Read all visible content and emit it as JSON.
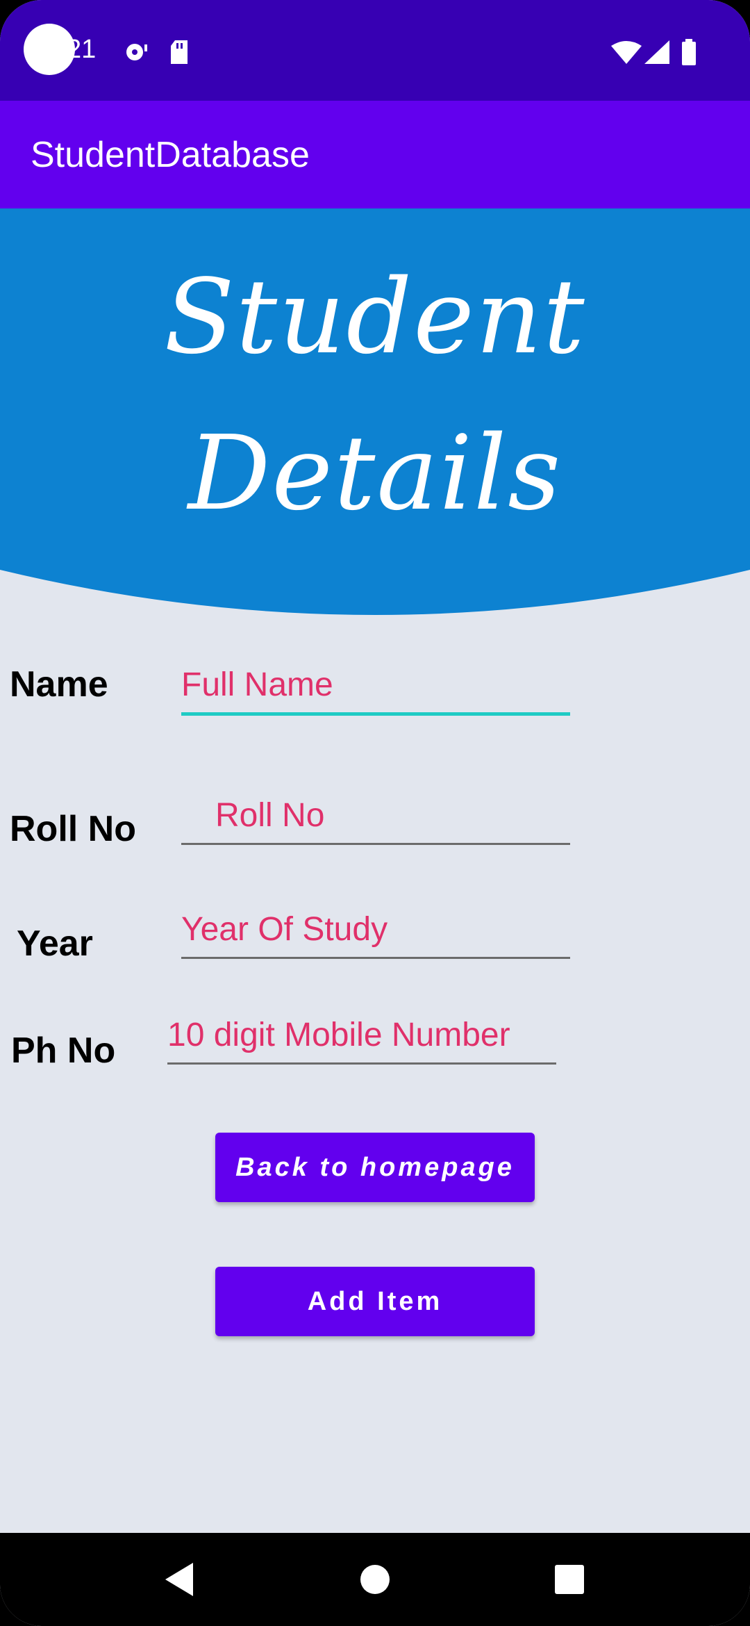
{
  "status_bar": {
    "time": "21",
    "icons": [
      "camera-dot",
      "media-icon",
      "sd-card-icon",
      "wifi-icon",
      "signal-icon",
      "battery-icon"
    ]
  },
  "app_bar": {
    "title": "StudentDatabase"
  },
  "banner": {
    "line1": "Student",
    "line2": "Details"
  },
  "form": {
    "name": {
      "label": "Name",
      "placeholder": "Full Name"
    },
    "roll": {
      "label": "Roll No",
      "placeholder": "Roll No"
    },
    "year": {
      "label": "Year",
      "placeholder": "Year Of Study"
    },
    "phone": {
      "label": "Ph No",
      "placeholder": "10 digit Mobile Number"
    }
  },
  "buttons": {
    "back": "Back to homepage",
    "add": "Add Item"
  },
  "nav_bar": {
    "icons": [
      "back-icon",
      "home-icon",
      "recents-icon"
    ]
  },
  "colors": {
    "status_bar": "#3700B3",
    "app_bar": "#6200EE",
    "banner": "#0D82D1",
    "background": "#E2E6EE",
    "hint_text": "#E0306A",
    "focus_underline": "#1ECBC4"
  }
}
